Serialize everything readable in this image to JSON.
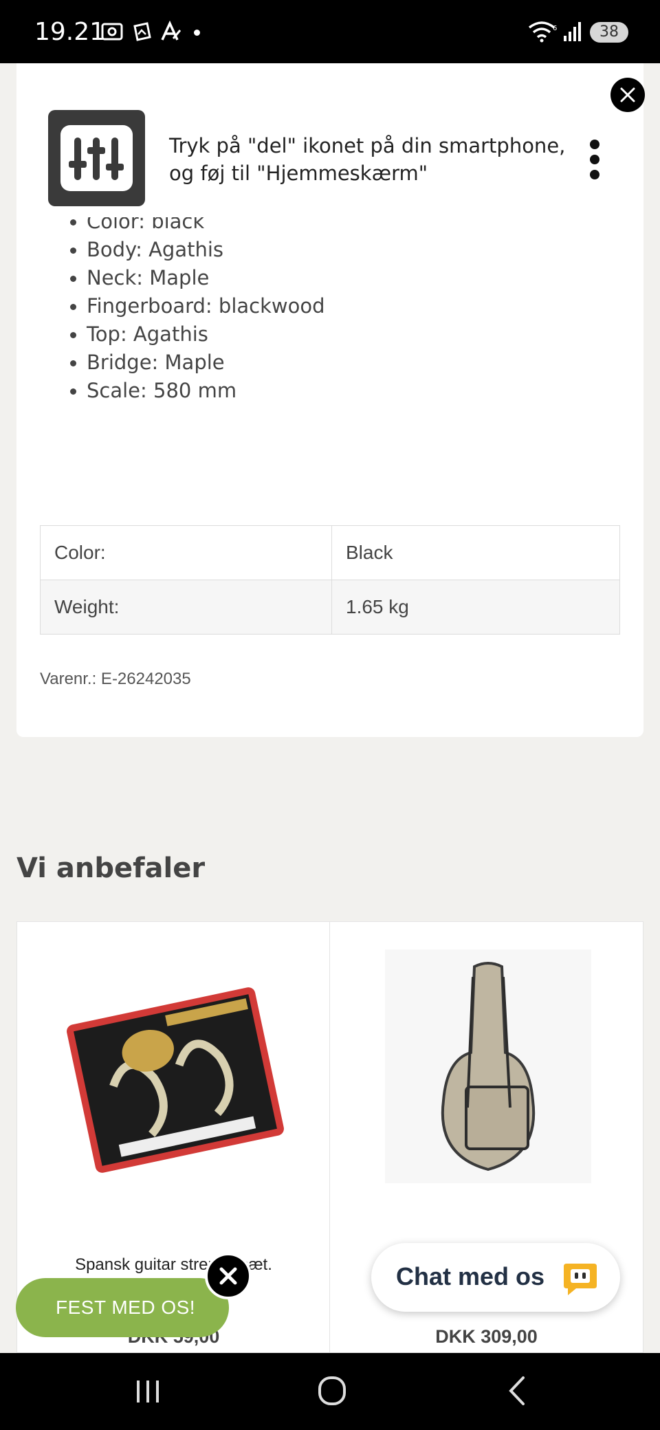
{
  "status_bar": {
    "time": "19.21",
    "battery": "38"
  },
  "a2hs_banner": {
    "message": "Tryk på \"del\" ikonet på din smartphone, og føj til \"Hjemmeskærm\""
  },
  "product": {
    "specs": [
      "Color: black",
      "Body: Agathis",
      "Neck: Maple",
      "Fingerboard: blackwood",
      "Top: Agathis",
      "Bridge: Maple",
      "Scale: 580 mm"
    ],
    "attributes": [
      {
        "key": "Color:",
        "value": "Black"
      },
      {
        "key": "Weight:",
        "value": "1.65 kg"
      }
    ],
    "sku": "Varenr.: E-26242035"
  },
  "recommendations": {
    "title": "Vi anbefaler",
    "items": [
      {
        "name": "Spansk guitar strenge sæt.",
        "price": "DKK 59,00",
        "image": "DADI classic guitar strings pack"
      },
      {
        "name": "",
        "price": "DKK 309,00",
        "image": "beige guitar gig bag"
      }
    ]
  },
  "floating": {
    "fest_label": "FEST MED OS!",
    "chat_label": "Chat med os"
  },
  "colors": {
    "accent_green": "#8bb44c",
    "page_bg": "#f2f1ee",
    "chat_icon": "#f5b324"
  }
}
